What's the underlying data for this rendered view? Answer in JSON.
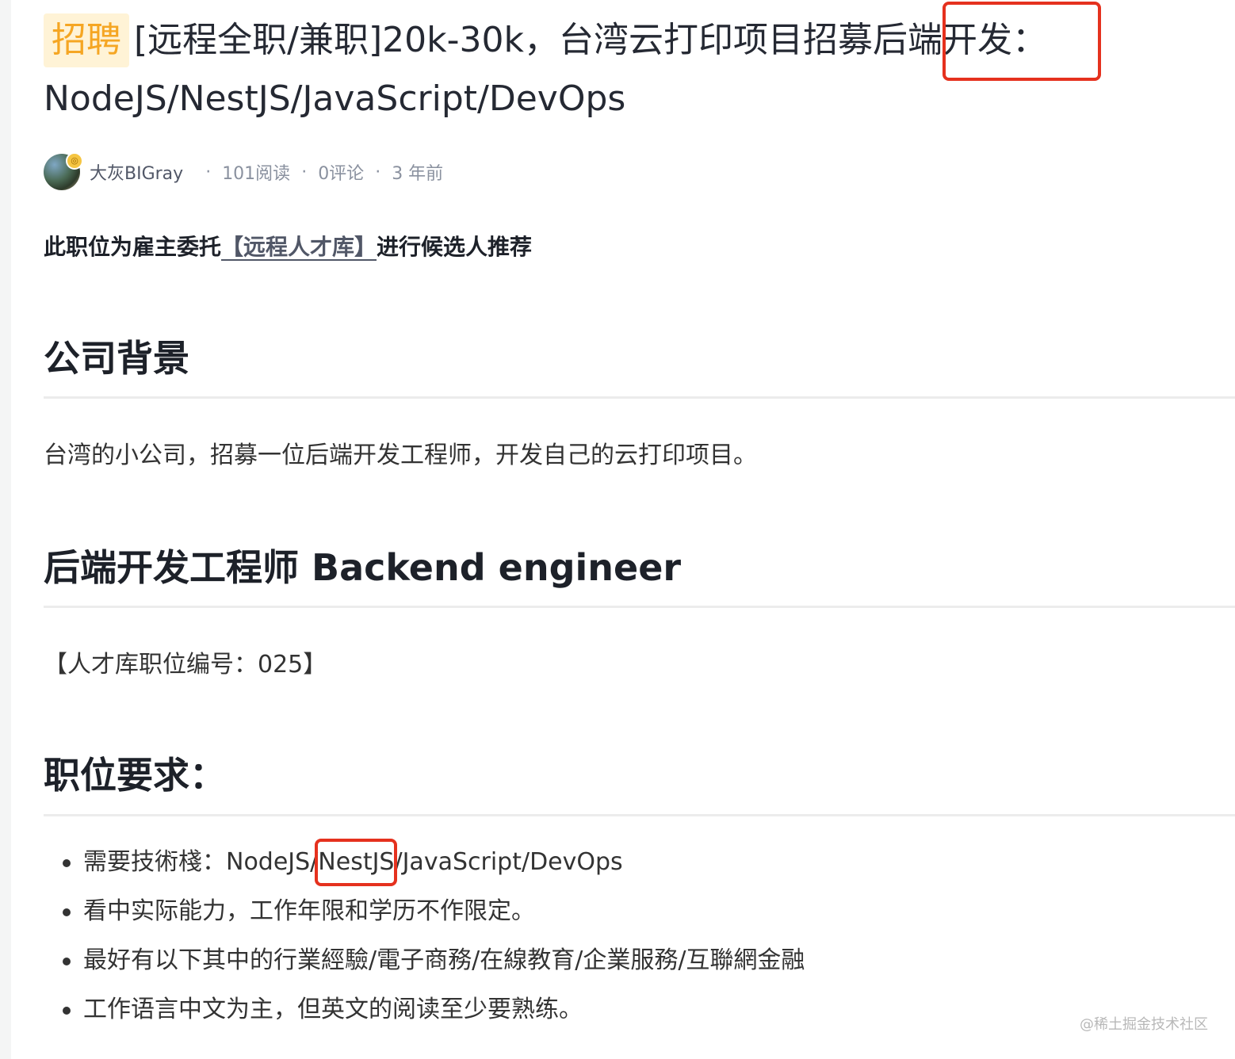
{
  "article": {
    "tag": "招聘",
    "title_main": "[远程全职/兼职]20k-30k，台湾云打印项目招募后端开发：",
    "title_line2": "NodeJS/NestJS/JavaScript/DevOps",
    "author": "大灰BIGray",
    "reads": "101阅读",
    "comments": "0评论",
    "time": "3 年前",
    "separator": "·",
    "intro_prefix": "此职位为雇主委托",
    "intro_link": "【远程人才库】",
    "intro_suffix": "进行候选人推荐"
  },
  "sections": {
    "company_heading": "公司背景",
    "company_text": "台湾的小公司，招募一位后端开发工程师，开发自己的云打印项目。",
    "role_heading": "后端开发工程师 Backend engineer",
    "role_code": "【人才库职位编号：025】",
    "req_heading": "职位要求：",
    "requirements": [
      "需要技術棧：NodeJS/NestJS/JavaScript/DevOps",
      "看中实际能力，工作年限和学历不作限定。",
      "最好有以下其中的行業經驗/電子商務/在線教育/企業服務/互聯網金融",
      "工作语言中文为主，但英文的阅读至少要熟练。"
    ]
  },
  "watermark": "@稀土掘金技术社区",
  "colors": {
    "highlight_box": "#e5311e",
    "tag_bg": "#fff3d6",
    "tag_fg": "#f5a623"
  }
}
